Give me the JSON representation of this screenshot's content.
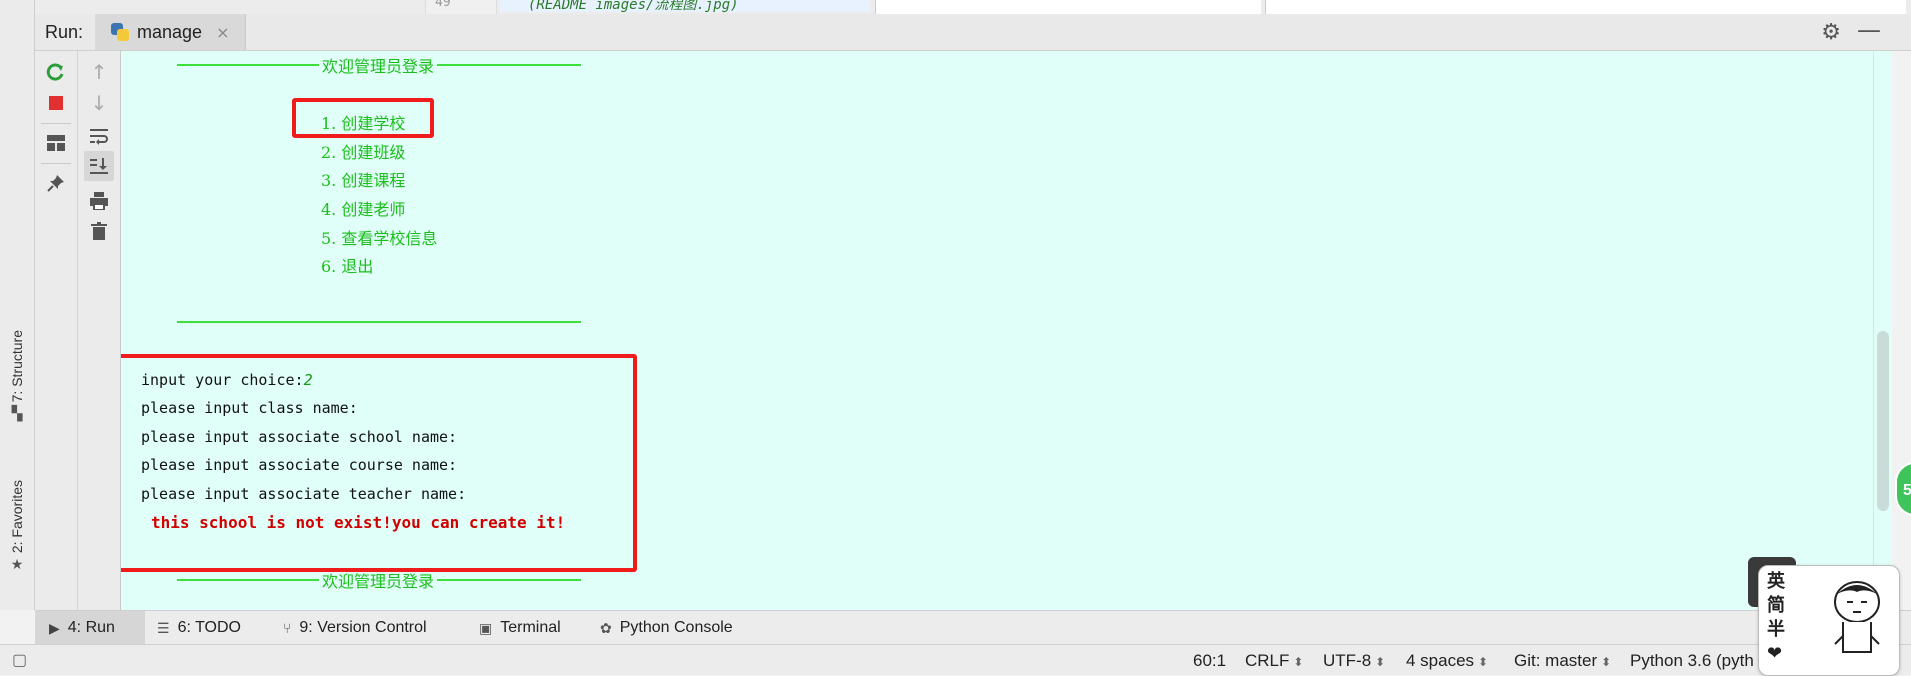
{
  "editor_peek": {
    "line_number": "49",
    "code_fragment": "(README images/流程图.jpg)"
  },
  "left_strip": {
    "structure_label": "7: Structure",
    "favorites_label": "2: Favorites"
  },
  "run_window": {
    "title": "Run:",
    "tab_label": "manage",
    "tab_close": "×",
    "settings_icon": "gear-icon",
    "minimize_icon": "minimize-icon"
  },
  "toolbar": {
    "rerun_icon": "rerun-icon",
    "stop_icon": "stop-icon",
    "layout_icon": "layout-icon",
    "pin_icon": "pin-icon",
    "up_icon": "arrow-up-icon",
    "down_icon": "arrow-down-icon",
    "softwrap_icon": "soft-wrap-icon",
    "scroll_end_icon": "scroll-to-end-icon",
    "print_icon": "print-icon",
    "trash_icon": "trash-icon"
  },
  "console": {
    "header_title": "欢迎管理员登录",
    "menu": [
      "1. 创建学校",
      "2. 创建班级",
      "3. 创建课程",
      "4. 创建老师",
      "5. 查看学校信息",
      "6. 退出"
    ],
    "prompt_choice": "input your choice:",
    "choice_value": "2",
    "prompts": [
      "please input class name:",
      "please input associate school name:",
      "please input associate course name:",
      "please input associate teacher name:"
    ],
    "error_message": "this school is not exist!you can create it!",
    "footer_title": "欢迎管理员登录",
    "highlight_color": "#f01c1c",
    "background_color": "#e0fff8",
    "menu_color": "#1bbf1b",
    "error_color": "#d20000"
  },
  "bottom_tabs": [
    {
      "label": "4: Run",
      "icon": "run-icon"
    },
    {
      "label": "6: TODO",
      "icon": "todo-icon"
    },
    {
      "label": "9: Version Control",
      "icon": "version-control-icon"
    },
    {
      "label": "Terminal",
      "icon": "terminal-icon"
    },
    {
      "label": "Python Console",
      "icon": "python-console-icon"
    }
  ],
  "status_bar": {
    "position": "60:1",
    "line_separator": "CRLF",
    "encoding": "UTF-8",
    "indent": "4 spaces",
    "git_branch": "Git: master",
    "interpreter": "Python 3.6 (pyth"
  },
  "overlays": {
    "bubble_text": "5",
    "ime_chars": [
      "英",
      "简",
      "半",
      "❤"
    ]
  }
}
